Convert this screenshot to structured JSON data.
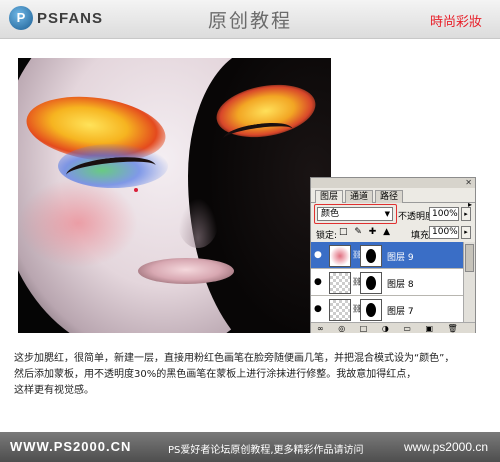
{
  "header": {
    "logo_letter": "P",
    "logo_text": "PSFANS",
    "title": "原创教程",
    "brand": "時尚彩妝"
  },
  "photoshop_panel": {
    "tabs": [
      "图层",
      "通道",
      "路径"
    ],
    "close_glyph": "✕",
    "menu_glyph": "▸",
    "blend_mode": "颜色",
    "opacity_label": "不透明度:",
    "opacity_value": "100%",
    "lock_label": "锁定:",
    "lock_icons": "□ ✎ ✚ ▲",
    "fill_label": "填充:",
    "fill_value": "100%",
    "layers": [
      {
        "name": "图层 9",
        "selected": true,
        "has_mask": true
      },
      {
        "name": "图层 8",
        "selected": false,
        "has_mask": true
      },
      {
        "name": "图层 7",
        "selected": false,
        "has_mask": true
      }
    ],
    "bottom_icons": "∞ ◎ □ ◑ ▭ ▣ 🗑"
  },
  "description": {
    "line1": "这步加腮红，很简单，新建一层，直接用粉红色画笔在脸旁随便画几笔，并把混合模式设为“颜色”，",
    "line2": "然后添加蒙板，用不透明度30%的黑色画笔在蒙板上进行涂抹进行修整。我故意加得红点，",
    "line3": "这样更有视觉感。"
  },
  "footer": {
    "left": "WWW.PS2000.CN",
    "middle": "PS爱好者论坛原创教程,更多精彩作品请访问",
    "right": "www.ps2000.cn"
  }
}
